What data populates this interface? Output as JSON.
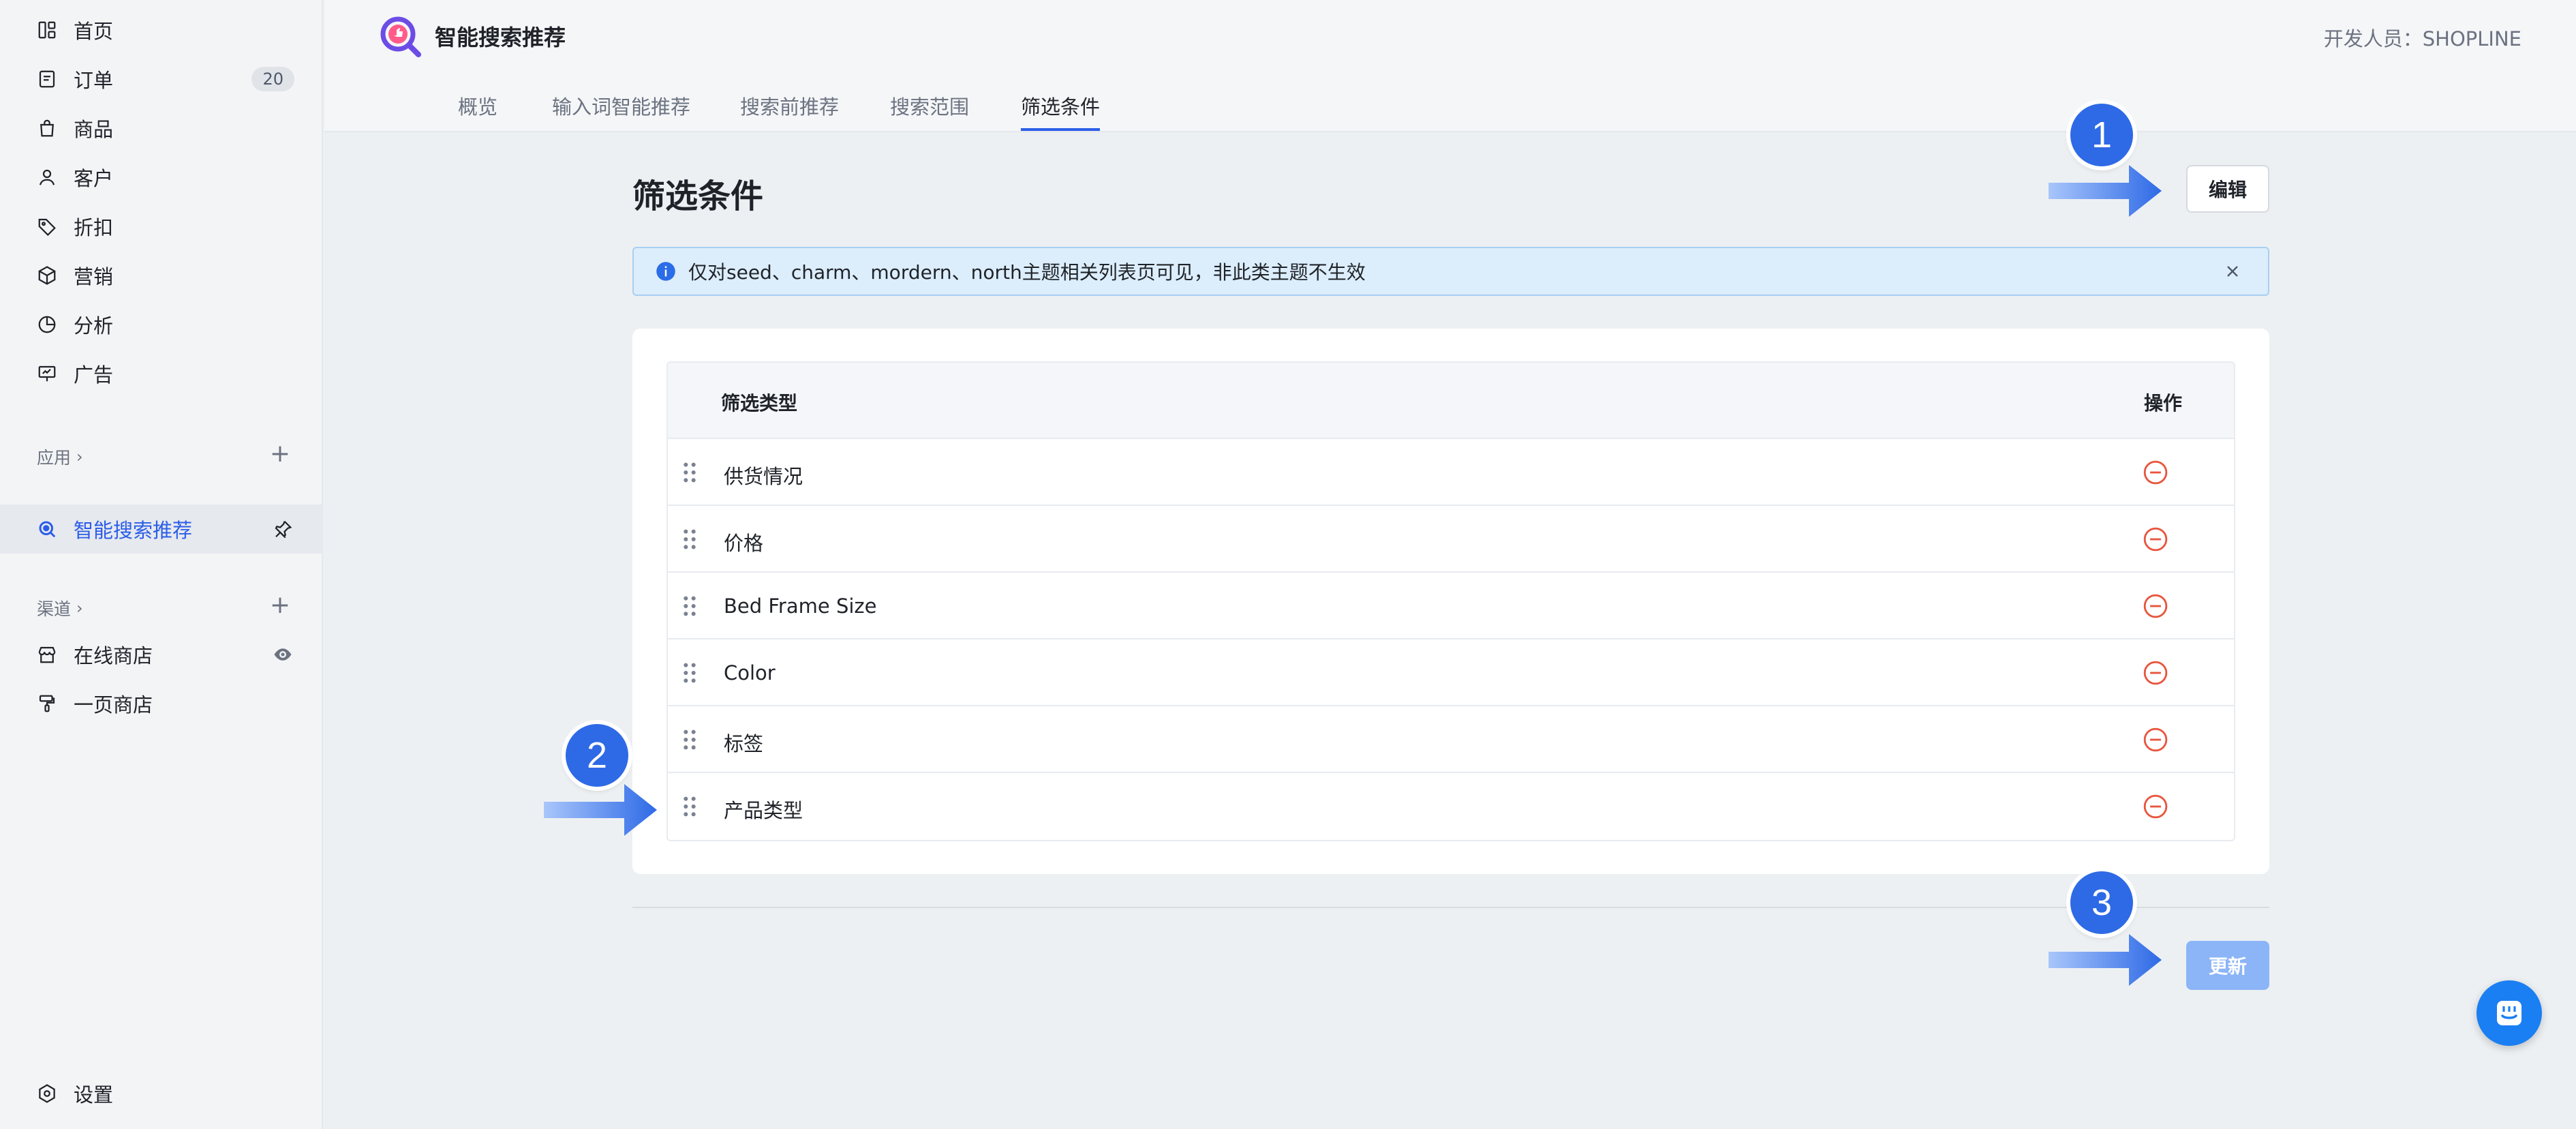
{
  "sidebar": {
    "items": [
      {
        "label": "首页",
        "icon": "home-icon"
      },
      {
        "label": "订单",
        "icon": "order-icon",
        "badge": "20"
      },
      {
        "label": "商品",
        "icon": "bag-icon"
      },
      {
        "label": "客户",
        "icon": "user-icon"
      },
      {
        "label": "折扣",
        "icon": "tag-icon"
      },
      {
        "label": "营销",
        "icon": "cube-icon"
      },
      {
        "label": "分析",
        "icon": "pie-icon"
      },
      {
        "label": "广告",
        "icon": "ad-icon"
      }
    ],
    "apps_label": "应用",
    "active_app": "智能搜索推荐",
    "channels_label": "渠道",
    "channels": [
      {
        "label": "在线商店",
        "icon": "store-icon"
      },
      {
        "label": "一页商店",
        "icon": "brush-icon"
      }
    ],
    "settings_label": "设置"
  },
  "header": {
    "app_title": "智能搜索推荐",
    "developer": "开发人员：SHOPLINE"
  },
  "tabs": [
    {
      "label": "概览"
    },
    {
      "label": "输入词智能推荐"
    },
    {
      "label": "搜索前推荐"
    },
    {
      "label": "搜索范围"
    },
    {
      "label": "筛选条件",
      "active": true
    }
  ],
  "main": {
    "page_title": "筛选条件",
    "edit_label": "编辑",
    "notice": "仅对seed、charm、mordern、north主题相关列表页可见，非此类主题不生效",
    "table": {
      "col_type": "筛选类型",
      "col_action": "操作",
      "rows": [
        {
          "name": "供货情况"
        },
        {
          "name": "价格"
        },
        {
          "name": "Bed Frame Size"
        },
        {
          "name": "Color"
        },
        {
          "name": "标签"
        },
        {
          "name": "产品类型"
        }
      ]
    },
    "update_label": "更新"
  },
  "annotations": {
    "step1": "1",
    "step2": "2",
    "step3": "3"
  },
  "colors": {
    "accent": "#2b5de8",
    "annotation": "#2e6ae6",
    "remove": "#e8553e",
    "update_disabled": "#8cb5f7"
  }
}
